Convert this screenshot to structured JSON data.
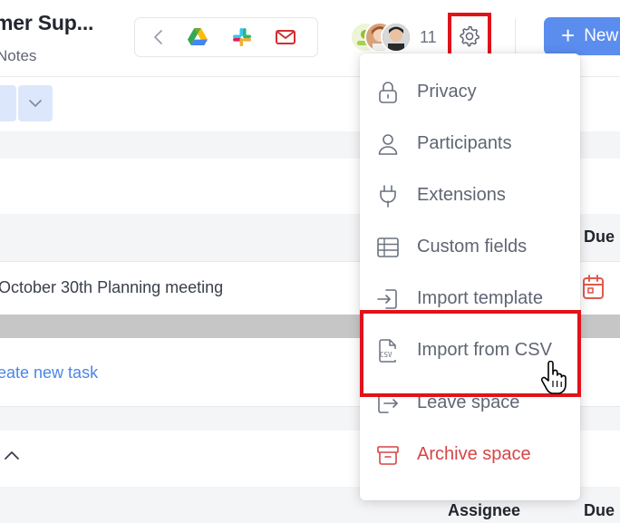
{
  "header": {
    "title": "mer Sup...",
    "subtitle": "Notes"
  },
  "integrations": [
    {
      "name": "back",
      "icon": "chevron-left-icon"
    },
    {
      "name": "google-drive",
      "icon": "google-drive-icon"
    },
    {
      "name": "slack",
      "icon": "slack-icon"
    },
    {
      "name": "email",
      "icon": "mail-icon"
    }
  ],
  "participants": {
    "count": "11"
  },
  "new_button": {
    "label": "New"
  },
  "table": {
    "due_header": "Due",
    "assignee_header": "Assignee",
    "task_name": "October 30th Planning meeting",
    "create_task_label": "eate new task"
  },
  "menu": {
    "items": [
      {
        "label": "Privacy",
        "icon": "lock-icon"
      },
      {
        "label": "Participants",
        "icon": "person-icon"
      },
      {
        "label": "Extensions",
        "icon": "plug-icon"
      },
      {
        "label": "Custom fields",
        "icon": "table-icon"
      },
      {
        "label": "Import template",
        "icon": "import-icon"
      },
      {
        "label": "Import from CSV",
        "icon": "csv-file-icon",
        "icon_text": "CSV"
      },
      {
        "label": "Leave space",
        "icon": "exit-icon"
      },
      {
        "label": "Archive space",
        "icon": "archive-icon",
        "style": "danger"
      }
    ]
  },
  "colors": {
    "accent": "#5b8def",
    "link": "#4a86e8",
    "danger": "#d64545",
    "highlight_frame": "#e0131a"
  }
}
